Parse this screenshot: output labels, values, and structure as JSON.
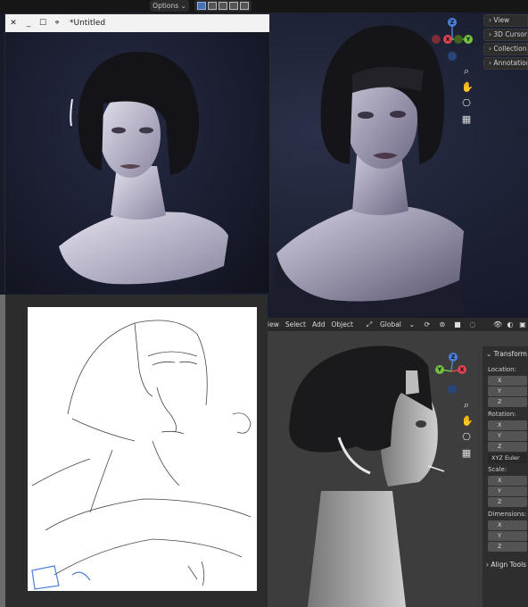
{
  "topbar": {
    "options_label": "Options",
    "options_caret": "⌄"
  },
  "viewport_top": {
    "npanel_tabs": [
      "View",
      "3D Cursor",
      "Collections",
      "Annotations"
    ],
    "gizmo": {
      "z": "Z",
      "y": "Y",
      "x": "X"
    },
    "tools": [
      "zoom-icon",
      "hand-icon",
      "camera-icon",
      "grid-icon"
    ]
  },
  "render_window": {
    "close_glyph": "✕",
    "minimize_glyph": "_",
    "maximize_glyph": "☐",
    "pin_glyph": "⌖",
    "title": "*Untitled"
  },
  "viewport_bottom": {
    "menu": [
      "iew",
      "Select",
      "Add",
      "Object"
    ],
    "orientation": "Global",
    "gizmo": {
      "z": "Z",
      "y": "Y",
      "x": "X"
    },
    "transform_panel": {
      "header": "Transform",
      "location_label": "Location:",
      "rotation_label": "Rotation:",
      "rotation_mode": "XYZ Euler",
      "scale_label": "Scale:",
      "dimensions_label": "Dimensions:",
      "axes": [
        "X",
        "Y",
        "Z"
      ],
      "align_tools": "Align Tools"
    }
  },
  "colors": {
    "axis_x": "#e04452",
    "axis_y": "#76c043",
    "axis_z": "#4a80d9",
    "accent": "#4772b3"
  }
}
